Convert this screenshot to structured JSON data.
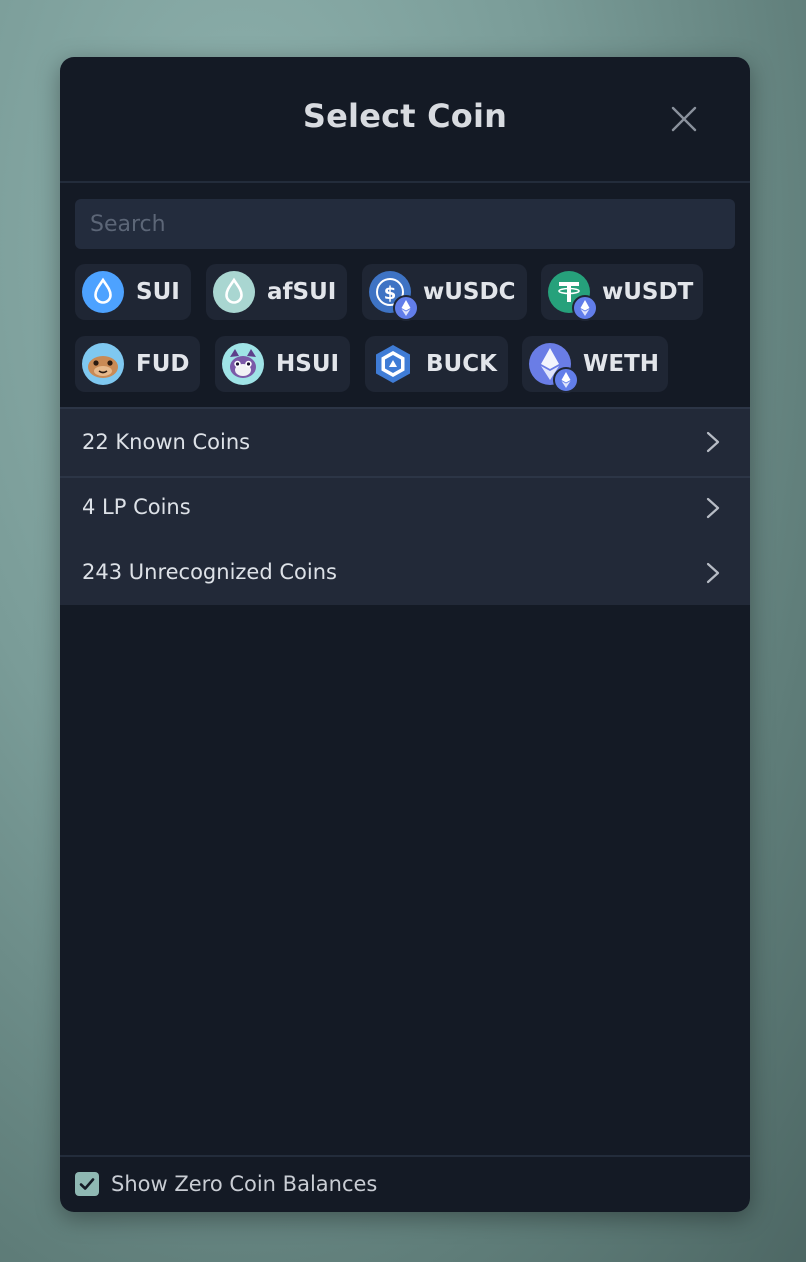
{
  "modal": {
    "title": "Select Coin",
    "close_icon": "close-icon"
  },
  "search": {
    "placeholder": "Search",
    "value": ""
  },
  "coins": [
    {
      "symbol": "SUI",
      "icon": "sui-icon",
      "color": "#4da2ff"
    },
    {
      "symbol": "afSUI",
      "icon": "afsui-icon",
      "color": "#a9d6d1"
    },
    {
      "symbol": "wUSDC",
      "icon": "usdc-icon",
      "color": "#3e73c4",
      "bridge": "ethereum-badge-icon"
    },
    {
      "symbol": "wUSDT",
      "icon": "usdt-icon",
      "color": "#26a17b",
      "bridge": "ethereum-badge-icon"
    },
    {
      "symbol": "FUD",
      "icon": "fud-icon",
      "color": "#7fc8f0"
    },
    {
      "symbol": "HSUI",
      "icon": "hsui-icon",
      "color": "#9fe3e6"
    },
    {
      "symbol": "BUCK",
      "icon": "buck-icon",
      "color": "#3f7cd6"
    },
    {
      "symbol": "WETH",
      "icon": "weth-icon",
      "color": "#6a7de6",
      "bridge": "ethereum-badge-icon"
    }
  ],
  "sections": [
    {
      "label": "22 Known Coins",
      "icon": "chevron-right-icon"
    },
    {
      "label": "4 LP Coins",
      "icon": "chevron-right-icon"
    },
    {
      "label": "243 Unrecognized Coins",
      "icon": "chevron-right-icon"
    }
  ],
  "footer": {
    "checkbox_label": "Show Zero Coin Balances",
    "checked": true
  },
  "colors": {
    "modal_bg": "#141a25",
    "row_bg": "#222938",
    "chip_bg": "#1f2634",
    "checkbox": "#8fb8b3"
  }
}
